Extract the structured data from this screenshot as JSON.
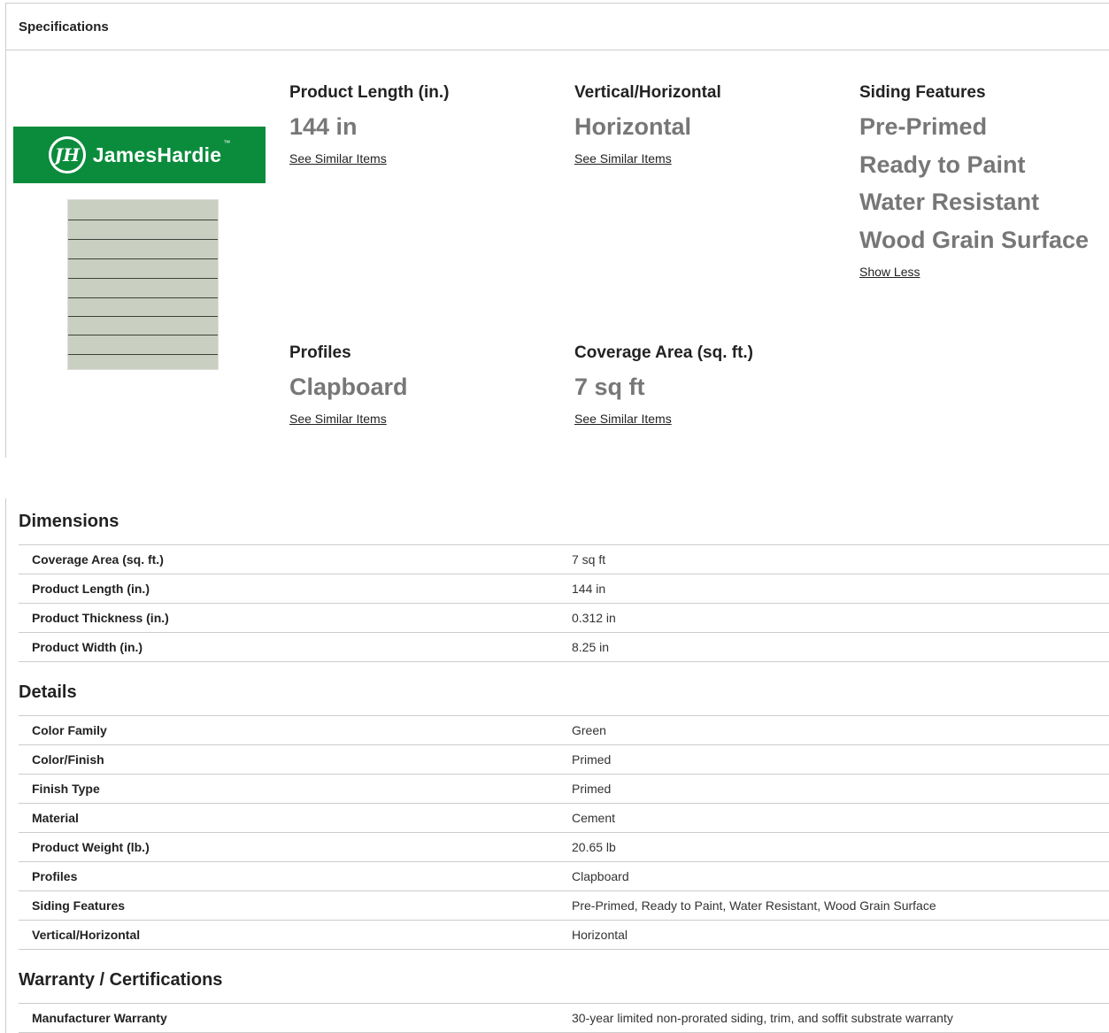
{
  "specifications": {
    "header": "Specifications",
    "brand": {
      "name": "JamesHardie",
      "monogram": "JH",
      "color": "#0a8c3c"
    },
    "attributes": {
      "product_length": {
        "title": "Product Length (in.)",
        "value": "144 in",
        "link": "See Similar Items"
      },
      "vertical_horizontal": {
        "title": "Vertical/Horizontal",
        "value": "Horizontal",
        "link": "See Similar Items"
      },
      "siding_features": {
        "title": "Siding Features",
        "values": [
          "Pre-Primed",
          "Ready to Paint",
          "Water Resistant",
          "Wood Grain Surface"
        ],
        "link": "Show Less"
      },
      "profiles": {
        "title": "Profiles",
        "value": "Clapboard",
        "link": "See Similar Items"
      },
      "coverage_area": {
        "title": "Coverage Area (sq. ft.)",
        "value": "7 sq ft",
        "link": "See Similar Items"
      }
    }
  },
  "dimensions": {
    "title": "Dimensions",
    "rows": [
      {
        "k": "Coverage Area (sq. ft.)",
        "v": "7 sq ft"
      },
      {
        "k": "Product Length (in.)",
        "v": "144 in"
      },
      {
        "k": "Product Thickness (in.)",
        "v": "0.312 in"
      },
      {
        "k": "Product Width (in.)",
        "v": "8.25 in"
      }
    ]
  },
  "details": {
    "title": "Details",
    "rows": [
      {
        "k": "Color Family",
        "v": "Green"
      },
      {
        "k": "Color/Finish",
        "v": "Primed"
      },
      {
        "k": "Finish Type",
        "v": "Primed"
      },
      {
        "k": "Material",
        "v": "Cement"
      },
      {
        "k": "Product Weight (lb.)",
        "v": "20.65 lb"
      },
      {
        "k": "Profiles",
        "v": "Clapboard"
      },
      {
        "k": "Siding Features",
        "v": "Pre-Primed, Ready to Paint, Water Resistant, Wood Grain Surface"
      },
      {
        "k": "Vertical/Horizontal",
        "v": "Horizontal"
      }
    ]
  },
  "warranty": {
    "title": "Warranty / Certifications",
    "rows": [
      {
        "k": "Manufacturer Warranty",
        "v": "30-year limited non-prorated siding, trim, and soffit substrate warranty"
      }
    ]
  }
}
